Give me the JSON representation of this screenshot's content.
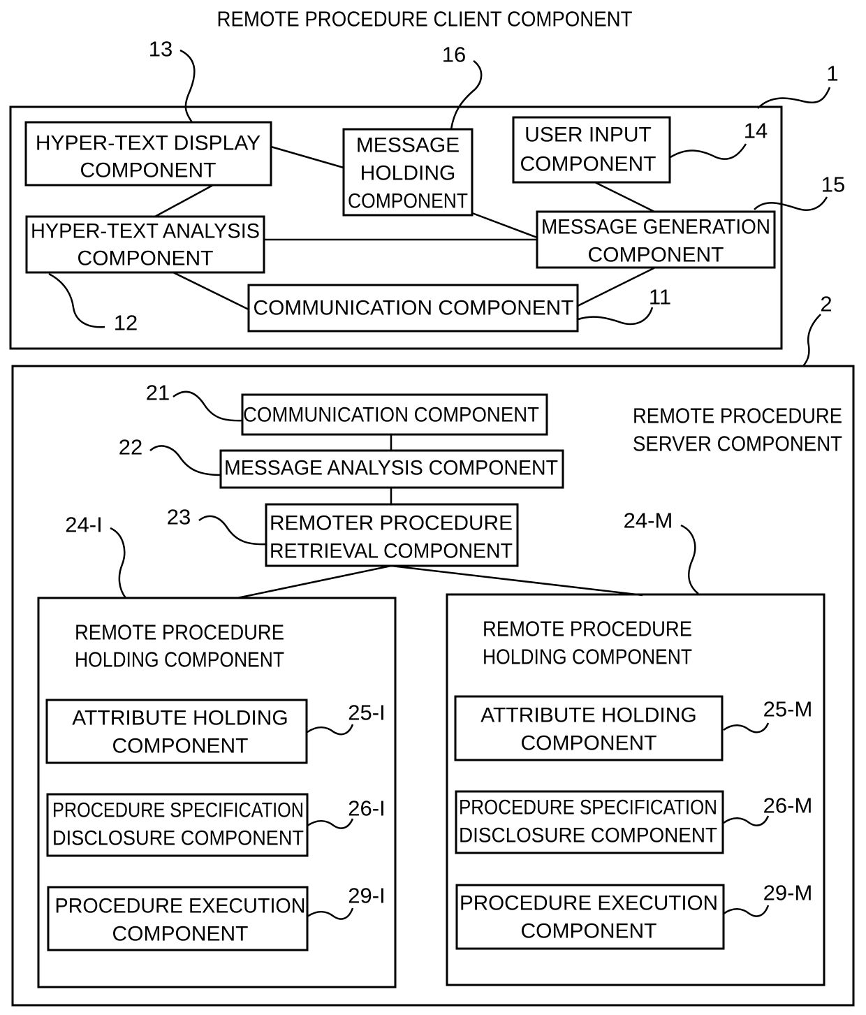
{
  "client": {
    "title": "REMOTE PROCEDURE CLIENT COMPONENT",
    "ref": "1",
    "components": {
      "hypertext_display": {
        "ref": "13",
        "lines": [
          "HYPER-TEXT DISPLAY",
          "COMPONENT"
        ]
      },
      "message_holding": {
        "ref": "16",
        "lines": [
          "MESSAGE",
          "HOLDING",
          "COMPONENT"
        ]
      },
      "user_input": {
        "ref": "14",
        "lines": [
          "USER INPUT",
          "COMPONENT"
        ]
      },
      "hypertext_analysis": {
        "ref": "12",
        "lines": [
          "HYPER-TEXT ANALYSIS",
          "COMPONENT"
        ]
      },
      "message_generation": {
        "ref": "15",
        "lines": [
          "MESSAGE GENERATION",
          "COMPONENT"
        ]
      },
      "communication": {
        "ref": "11",
        "lines": [
          "COMMUNICATION COMPONENT"
        ]
      }
    }
  },
  "server": {
    "title_lines": [
      "REMOTE PROCEDURE",
      "SERVER COMPONENT"
    ],
    "ref": "2",
    "components": {
      "communication": {
        "ref": "21",
        "lines": [
          "COMMUNICATION COMPONENT"
        ]
      },
      "message_analysis": {
        "ref": "22",
        "lines": [
          "MESSAGE ANALYSIS COMPONENT"
        ]
      },
      "retrieval": {
        "ref": "23",
        "lines": [
          "REMOTER PROCEDURE",
          "RETRIEVAL COMPONENT"
        ]
      }
    },
    "holding_groups": [
      {
        "ref": "24-I",
        "title_lines": [
          "REMOTE PROCEDURE",
          "HOLDING COMPONENT"
        ],
        "items": [
          {
            "ref": "25-I",
            "lines": [
              "ATTRIBUTE HOLDING",
              "COMPONENT"
            ]
          },
          {
            "ref": "26-I",
            "lines": [
              "PROCEDURE SPECIFICATION",
              "DISCLOSURE COMPONENT"
            ]
          },
          {
            "ref": "29-I",
            "lines": [
              "PROCEDURE EXECUTION",
              "COMPONENT"
            ]
          }
        ]
      },
      {
        "ref": "24-M",
        "title_lines": [
          "REMOTE PROCEDURE",
          "HOLDING COMPONENT"
        ],
        "items": [
          {
            "ref": "25-M",
            "lines": [
              "ATTRIBUTE HOLDING",
              "COMPONENT"
            ]
          },
          {
            "ref": "26-M",
            "lines": [
              "PROCEDURE SPECIFICATION",
              "DISCLOSURE COMPONENT"
            ]
          },
          {
            "ref": "29-M",
            "lines": [
              "PROCEDURE EXECUTION",
              "COMPONENT"
            ]
          }
        ]
      }
    ]
  }
}
